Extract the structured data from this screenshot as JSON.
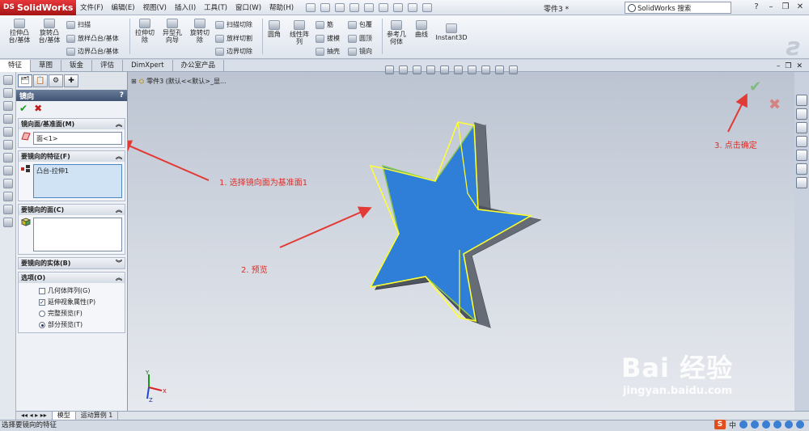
{
  "app": {
    "name": "SolidWorks",
    "doc_title": "零件3 *"
  },
  "menu": [
    "文件(F)",
    "编辑(E)",
    "视图(V)",
    "插入(I)",
    "工具(T)",
    "窗口(W)",
    "帮助(H)"
  ],
  "search": {
    "placeholder": "SolidWorks 搜索"
  },
  "ribbon": {
    "extrude_boss": "拉伸凸\n台/基体",
    "revolve_boss": "旋转凸\n台/基体",
    "sweep": "扫描",
    "loft": "放样凸台/基体",
    "boundary": "边界凸台/基体",
    "extrude_cut": "拉伸切\n除",
    "hole_wizard": "异型孔\n向导",
    "revolve_cut": "旋转切\n除",
    "sweep_cut": "扫描切除",
    "loft_cut": "放样切割",
    "boundary_cut": "边界切除",
    "fillet": "圆角",
    "linear_pattern": "线性阵\n列",
    "rib": "筋",
    "draft": "拔模",
    "shell": "抽壳",
    "wrap": "包覆",
    "dome": "圆顶",
    "mirror": "镜向",
    "ref_geometry": "参考几\n何体",
    "curves": "曲线",
    "instant3d": "Instant3D"
  },
  "command_tabs": [
    "特征",
    "草图",
    "钣金",
    "评估",
    "DimXpert",
    "办公室产品"
  ],
  "property_manager": {
    "title": "镜向",
    "help": "?",
    "mirror_face_group": {
      "title": "镜向面/基准面(M)",
      "value": "面<1>"
    },
    "features_group": {
      "title": "要镜向的特征(F)",
      "items": [
        "凸台-拉伸1"
      ]
    },
    "faces_group": {
      "title": "要镜向的面(C)"
    },
    "bodies_group": {
      "title": "要镜向的实体(B)"
    },
    "options_group": {
      "title": "选项(O)",
      "geometry_pattern": "几何体阵列(G)",
      "propagate_visual": "延伸视象属性(P)",
      "full_preview": "完整预览(F)",
      "partial_preview": "部分预览(T)"
    }
  },
  "tree_flyout": "零件3  (默认<<默认>_显...",
  "annotations": {
    "step1": "1. 选择镜向面为基准面1",
    "step2": "2. 预览",
    "step3": "3. 点击确定"
  },
  "bottom_tabs": [
    "模型",
    "运动算例 1"
  ],
  "status": "选择要镜向的特征",
  "tray": {
    "ime": "S",
    "lang": "中"
  },
  "watermark": {
    "main": "Bai 经验",
    "sub": "jingyan.baidu.com"
  },
  "colors": {
    "accent_red": "#d8302b",
    "star_blue": "#2f7fd8",
    "highlight_yellow": "#ffff33"
  }
}
